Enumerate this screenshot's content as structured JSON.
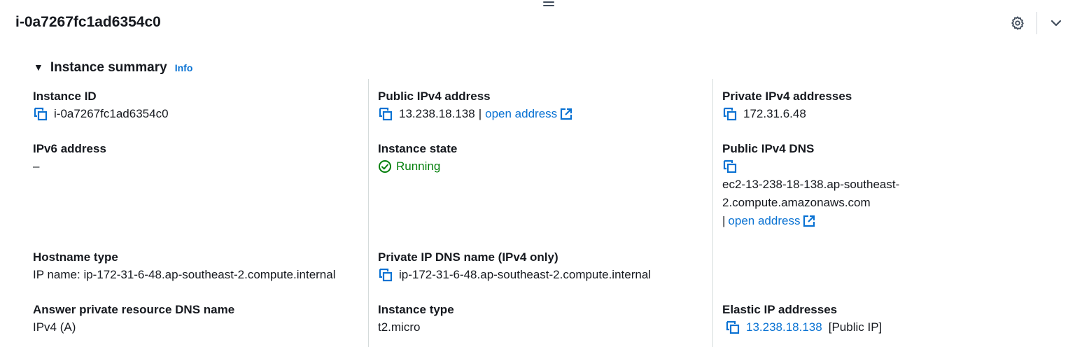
{
  "header": {
    "title": "i-0a7267fc1ad6354c0"
  },
  "section": {
    "title": "Instance summary",
    "info_label": "Info"
  },
  "fields": {
    "instance_id": {
      "label": "Instance ID",
      "value": "i-0a7267fc1ad6354c0"
    },
    "public_ipv4": {
      "label": "Public IPv4 address",
      "value": "13.238.18.138",
      "separator": "|",
      "link": "open address"
    },
    "private_ipv4": {
      "label": "Private IPv4 addresses",
      "value": "172.31.6.48"
    },
    "ipv6": {
      "label": "IPv6 address",
      "value": "–"
    },
    "instance_state": {
      "label": "Instance state",
      "value": "Running"
    },
    "public_dns": {
      "label": "Public IPv4 DNS",
      "value_line1": "ec2-13-238-18-138.ap-southeast-",
      "value_line2": "2.compute.amazonaws.com",
      "separator": "|",
      "link": "open address"
    },
    "hostname_type": {
      "label": "Hostname type",
      "value": "IP name: ip-172-31-6-48.ap-southeast-2.compute.internal"
    },
    "private_dns": {
      "label": "Private IP DNS name (IPv4 only)",
      "value": "ip-172-31-6-48.ap-southeast-2.compute.internal"
    },
    "answer_dns": {
      "label": "Answer private resource DNS name",
      "value": "IPv4 (A)"
    },
    "instance_type": {
      "label": "Instance type",
      "value": "t2.micro"
    },
    "elastic_ip": {
      "label": "Elastic IP addresses",
      "value": "13.238.18.138",
      "suffix": "[Public IP]"
    }
  },
  "colors": {
    "link": "#0972d3",
    "success": "#037f0c",
    "text": "#16191f",
    "divider": "#d5dbdb"
  },
  "icons": {
    "copy": "copy-icon",
    "external": "external-link-icon",
    "settings": "gear-icon",
    "collapse": "chevron-down-icon",
    "status": "check-circle-icon",
    "drag": "drag-handle-icon"
  }
}
